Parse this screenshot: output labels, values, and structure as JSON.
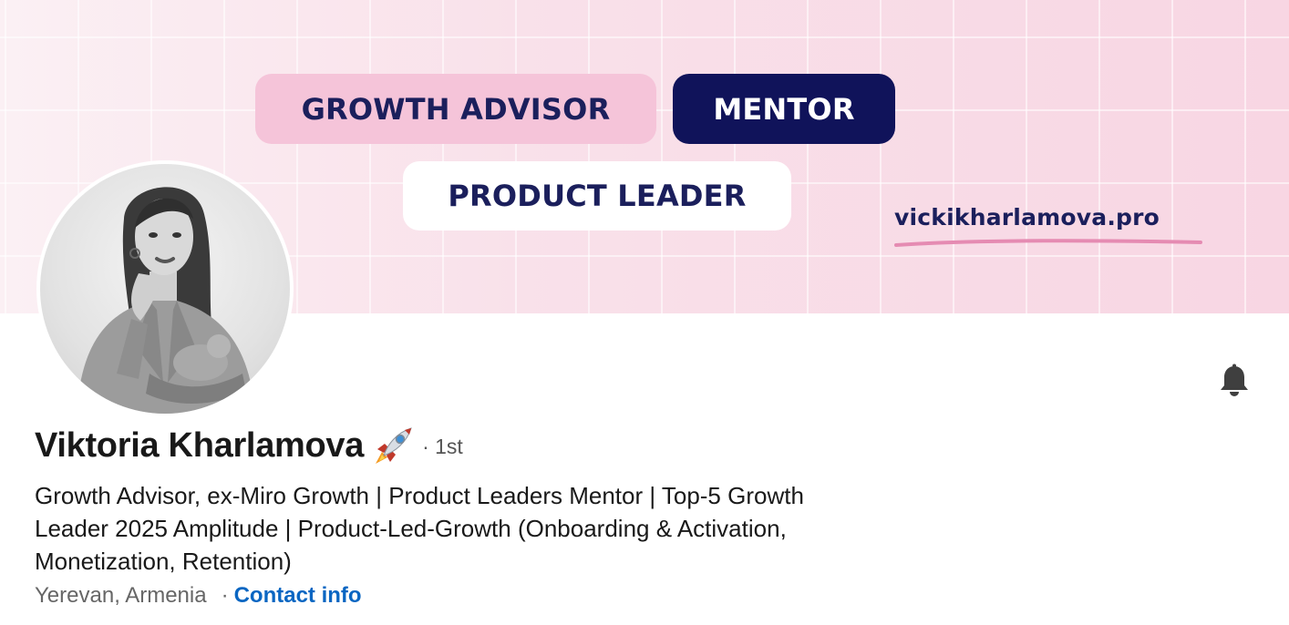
{
  "banner": {
    "pill_growth": "GROWTH ADVISOR",
    "pill_mentor": "MENTOR",
    "pill_product": "PRODUCT LEADER",
    "url": "vickikharlamova.pro"
  },
  "profile": {
    "name": "Viktoria Kharlamova",
    "name_emoji": "rocket-icon",
    "degree": "· 1st",
    "headline": "Growth Advisor, ex-Miro Growth | Product Leaders Mentor | Top-5 Growth Leader 2025 Amplitude | Product-Led-Growth (Onboarding & Activation, Monetization, Retention)",
    "location": "Yerevan, Armenia",
    "separator": "·",
    "contact_info": "Contact info"
  },
  "actions": {
    "bell_icon": "bell-icon"
  },
  "colors": {
    "banner_pink": "#f8d6e3",
    "pill_pink": "#f5c4d9",
    "navy": "#10135a",
    "link_blue": "#0a66c2",
    "underline_pink": "#e58bb2"
  }
}
